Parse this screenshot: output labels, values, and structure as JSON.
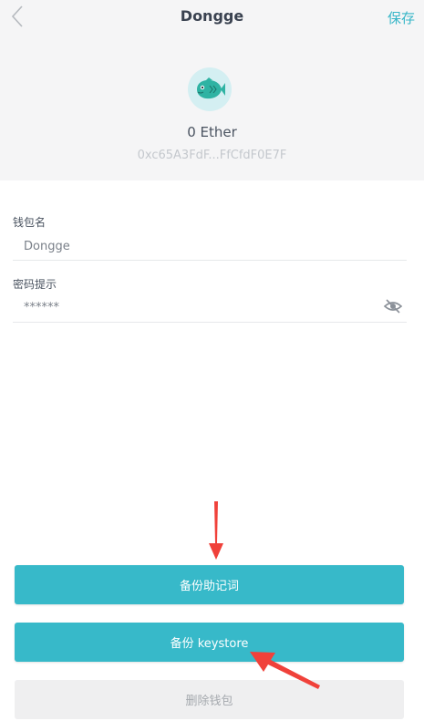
{
  "header": {
    "title": "Dongge",
    "save_label": "保存",
    "balance": "0 Ether",
    "address": "0xc65A3FdF...FfCfdF0E7F"
  },
  "form": {
    "wallet_name_label": "钱包名",
    "wallet_name_value": "Dongge",
    "password_hint_label": "密码提示",
    "password_hint_value": "******"
  },
  "buttons": {
    "backup_mnemonic": "备份助记词",
    "backup_keystore": "备份 keystore",
    "delete_wallet": "删除钱包"
  },
  "colors": {
    "accent": "#37b9c9",
    "annotation_arrow": "#f0413a"
  },
  "icons": {
    "back": "chevron-left-icon",
    "avatar": "fish-avatar-icon",
    "visibility": "eye-off-icon"
  }
}
